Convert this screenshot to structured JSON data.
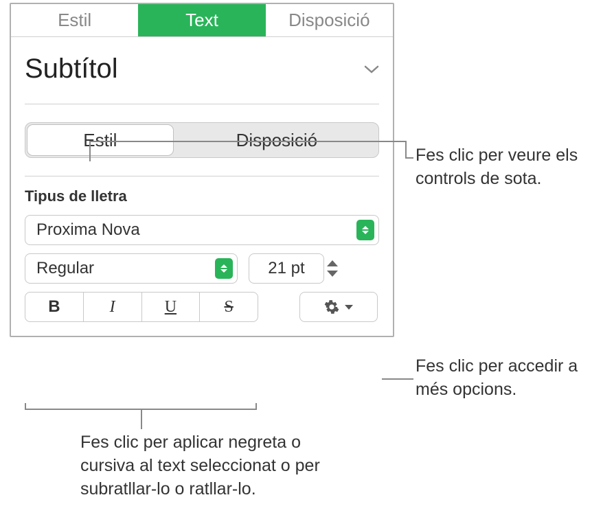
{
  "tabs": {
    "style": "Estil",
    "text": "Text",
    "layout": "Disposició"
  },
  "paragraph_style": {
    "name": "Subtítol"
  },
  "sub_tabs": {
    "style": "Estil",
    "layout": "Disposició"
  },
  "font_section": {
    "label": "Tipus de lletra",
    "family": "Proxima Nova",
    "weight": "Regular",
    "size": "21 pt"
  },
  "style_buttons": {
    "bold": "B",
    "italic": "I",
    "underline": "U",
    "strike": "S"
  },
  "callouts": {
    "subtabs": "Fes clic per veure els controls de sota.",
    "more": "Fes clic per accedir a més opcions.",
    "styles": "Fes clic per aplicar negreta o cursiva al text seleccionat o per subratllar-lo o ratllar-lo."
  }
}
